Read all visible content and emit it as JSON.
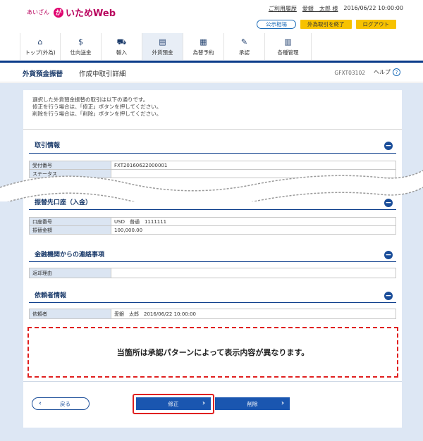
{
  "brand": {
    "small": "あいざん",
    "mark": "が",
    "name": "いためWeb"
  },
  "user_bar": {
    "history_link": "ご利用履歴",
    "user_name": "愛銀　太郎 様",
    "datetime": "2016/06/22 10:00:00"
  },
  "top_buttons": {
    "public_rate": "公示相場",
    "end_fx": "外為取引を終了",
    "logout": "ログアウト"
  },
  "gnav": [
    {
      "label": "トップ(外為)",
      "icon": "home-icon",
      "glyph": "⌂"
    },
    {
      "label": "仕向送金",
      "icon": "remittance-icon",
      "glyph": "$"
    },
    {
      "label": "輸入",
      "icon": "import-icon",
      "glyph": "⛟"
    },
    {
      "label": "外貨預金",
      "icon": "deposit-icon",
      "glyph": "▤"
    },
    {
      "label": "為替予約",
      "icon": "fx-contract-icon",
      "glyph": "▦"
    },
    {
      "label": "承認",
      "icon": "approval-icon",
      "glyph": "✎"
    },
    {
      "label": "各種管理",
      "icon": "settings-icon",
      "glyph": "▥"
    }
  ],
  "title": {
    "main": "外貨預金振替",
    "sub": "作成中取引詳細",
    "screen_id": "GFXT03102",
    "help": "ヘルプ"
  },
  "intro": [
    "選択した外貨預金振替の取引は以下の通りです。",
    "修正を行う場合は、「修正」ボタンを押してください。",
    "削除を行う場合は、「削除」ボタンを押してください。"
  ],
  "sections": {
    "transaction": {
      "title": "取引情報",
      "rows": [
        {
          "label": "受付番号",
          "value": "FXT20160622000001"
        },
        {
          "label": "ステータス",
          "value": ""
        }
      ]
    },
    "destination": {
      "title": "振替先口座（入金）",
      "rows": [
        {
          "label": "口座番号",
          "value": "USD　普通　1111111"
        },
        {
          "label": "振替金額",
          "value": "100,000.00"
        }
      ]
    },
    "bank_notice": {
      "title": "金融機関からの連絡事項",
      "rows": [
        {
          "label": "返却理由",
          "value": ""
        }
      ]
    },
    "requester": {
      "title": "依頼者情報",
      "rows": [
        {
          "label": "依頼者",
          "value": "愛銀　太郎　2016/06/22 10:00:00"
        }
      ]
    }
  },
  "note": "当箇所は承認パターンによって表示内容が異なります。",
  "buttons": {
    "back": "戻る",
    "modify": "修正",
    "delete": "削除"
  },
  "colors": {
    "navy": "#0b3c8a",
    "accent": "#1a56b0",
    "highlight": "#e02020"
  }
}
